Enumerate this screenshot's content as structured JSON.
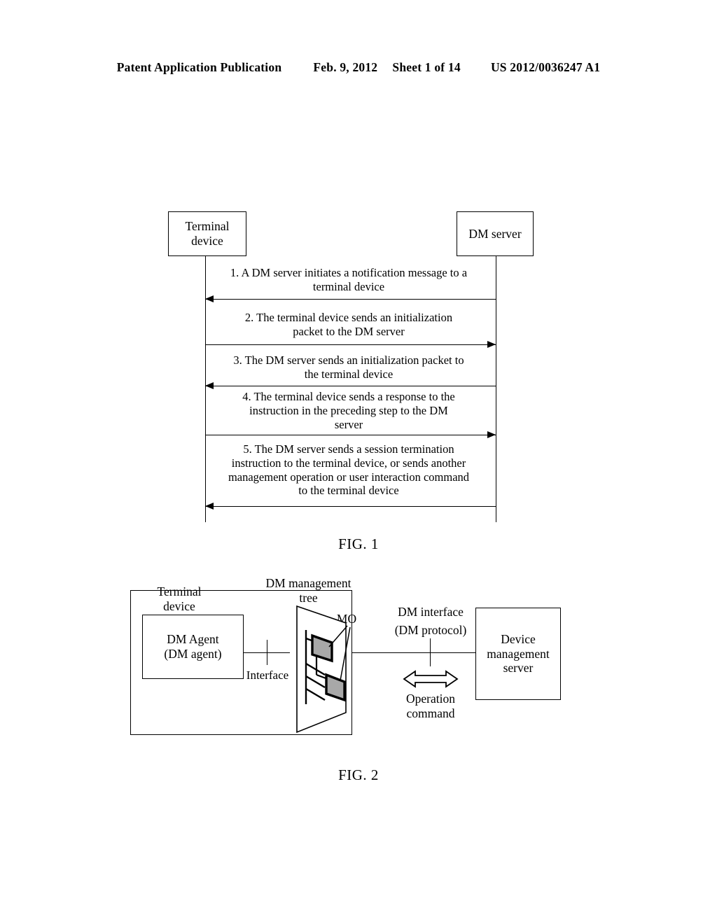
{
  "header": {
    "publication": "Patent Application Publication",
    "date": "Feb. 9, 2012",
    "sheet": "Sheet 1 of 14",
    "number": "US 2012/0036247 A1"
  },
  "figure1": {
    "caption": "FIG. 1",
    "actors": [
      {
        "name": "terminal-device",
        "label": "Terminal\ndevice"
      },
      {
        "name": "dm-server",
        "label": "DM server"
      }
    ],
    "messages": [
      {
        "step": "1",
        "text": "1. A DM server initiates a notification message to a\nterminal device",
        "direction": "left",
        "from": "dm-server",
        "to": "terminal-device"
      },
      {
        "step": "2",
        "text": "2. The terminal device sends an initialization\npacket to the DM server",
        "direction": "right",
        "from": "terminal-device",
        "to": "dm-server"
      },
      {
        "step": "3",
        "text": "3. The DM server sends an initialization packet to\nthe terminal device",
        "direction": "left",
        "from": "dm-server",
        "to": "terminal-device"
      },
      {
        "step": "4",
        "text": "4. The terminal device sends a response to the\ninstruction in the preceding step to the DM\nserver",
        "direction": "right",
        "from": "terminal-device",
        "to": "dm-server"
      },
      {
        "step": "5",
        "text": "5. The DM server sends a session termination\ninstruction to the terminal device, or sends another\nmanagement operation or user interaction command\nto the terminal device",
        "direction": "left",
        "from": "dm-server",
        "to": "terminal-device"
      }
    ]
  },
  "figure2": {
    "caption": "FIG. 2",
    "terminal_device_label": "Terminal\ndevice",
    "dm_agent_label": "DM Agent\n(DM agent)",
    "interface_label": "Interface",
    "tree_label": "DM management\ntree",
    "mo_label": "MO",
    "dm_interface_label": "DM interface",
    "dm_protocol_label": "(DM protocol)",
    "operation_command_label": "Operation\ncommand",
    "server_label": "Device\nmanagement\nserver"
  },
  "colors": {
    "ink": "#000000",
    "paper": "#ffffff",
    "mo_fill": "#a8a8a8"
  }
}
